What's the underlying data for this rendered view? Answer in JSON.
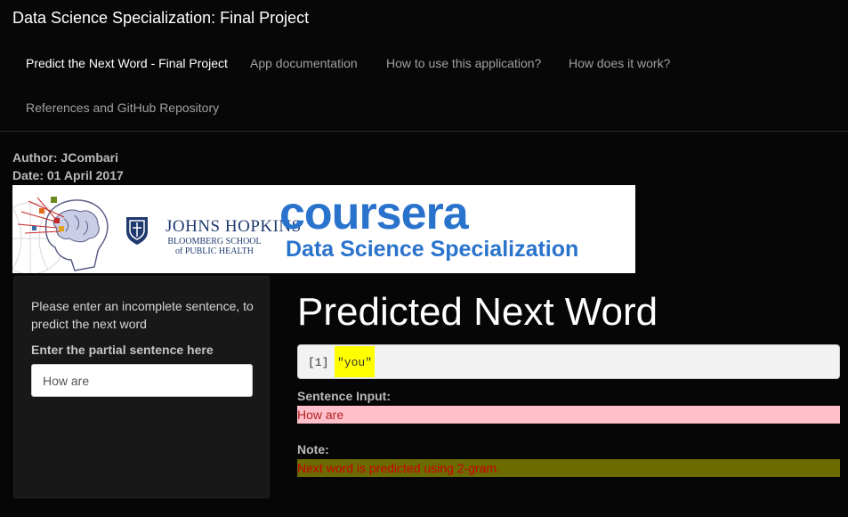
{
  "navbar": {
    "brand": "Data Science Specialization: Final Project",
    "tabs": [
      {
        "label": "Predict the Next Word - Final Project",
        "active": true
      },
      {
        "label": "App documentation",
        "active": false
      },
      {
        "label": "How to use this application?",
        "active": false
      },
      {
        "label": "How does it work?",
        "active": false
      },
      {
        "label": "References and GitHub Repository",
        "active": false
      }
    ]
  },
  "meta": {
    "author": "Author: JCombari",
    "date": "Date: 01 April 2017"
  },
  "banner": {
    "jh_name": "JOHNS HOPKINS",
    "jh_line1": "BLOOMBERG SCHOOL",
    "jh_line2": "of PUBLIC HEALTH",
    "coursera": "coursera",
    "specialization": "Data Science Specialization"
  },
  "sidebar": {
    "instructions": "Please enter an incomplete sentence, to predict the next word",
    "input_label": "Enter the partial sentence here",
    "input_value": "How are"
  },
  "main": {
    "title": "Predicted Next Word",
    "output_index": "[1]",
    "output_value": "\"you\"",
    "sentence_label": "Sentence Input:",
    "sentence_value": "How are",
    "note_label": "Note:",
    "note_value": "Next word is predicted using 2-gram."
  },
  "colors": {
    "background": "#060606",
    "sentence_bg": "#ffc0cb",
    "note_bg": "#6b6b00",
    "prediction_highlight": "#ffff00",
    "coursera_blue": "#2a73cc",
    "jh_blue": "#1f3a6e"
  }
}
